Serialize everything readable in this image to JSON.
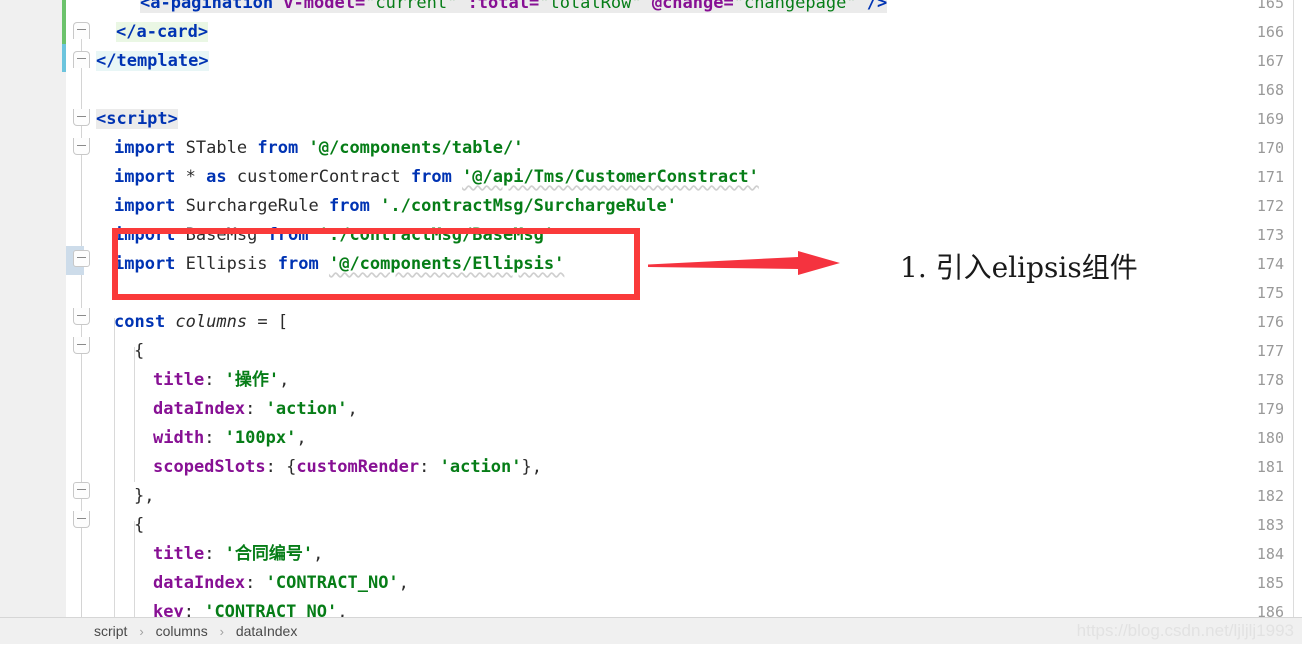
{
  "editor": {
    "language": "vue-javascript",
    "first_visible_line": 165,
    "last_visible_line": 186,
    "line_numbers": [
      165,
      166,
      167,
      168,
      169,
      170,
      171,
      172,
      173,
      174,
      175,
      176,
      177,
      178,
      179,
      180,
      181,
      182,
      183,
      184,
      185,
      186
    ],
    "lines": [
      {
        "n": 165,
        "text": "      <a-pagination v-model=\"current\" :total=\"totalRow\" @change=\"changepage\" />"
      },
      {
        "n": 166,
        "text": "    </a-card>"
      },
      {
        "n": 167,
        "text": "  </template>"
      },
      {
        "n": 168,
        "text": ""
      },
      {
        "n": 169,
        "text": "  <script>"
      },
      {
        "n": 170,
        "text": "    import STable from '@/components/table/'"
      },
      {
        "n": 171,
        "text": "    import * as customerContract from '@/api/Tms/CustomerConstract'"
      },
      {
        "n": 172,
        "text": "    import SurchargeRule from './contractMsg/SurchargeRule'"
      },
      {
        "n": 173,
        "text": "    import BaseMsg from './contractMsg/BaseMsg'"
      },
      {
        "n": 174,
        "text": "    import Ellipsis from '@/components/Ellipsis'"
      },
      {
        "n": 175,
        "text": ""
      },
      {
        "n": 176,
        "text": "    const columns = ["
      },
      {
        "n": 177,
        "text": "      {"
      },
      {
        "n": 178,
        "text": "        title: '操作',"
      },
      {
        "n": 179,
        "text": "        dataIndex: 'action',"
      },
      {
        "n": 180,
        "text": "        width: '100px',"
      },
      {
        "n": 181,
        "text": "        scopedSlots: {customRender: 'action'},"
      },
      {
        "n": 182,
        "text": "      },"
      },
      {
        "n": 183,
        "text": "      {"
      },
      {
        "n": 184,
        "text": "        title: '合同编号',"
      },
      {
        "n": 185,
        "text": "        dataIndex: 'CONTRACT_NO',"
      },
      {
        "n": 186,
        "text": "        key: 'CONTRACT_NO',"
      }
    ],
    "tokens": {
      "line165": [
        {
          "t": "<a-pagination ",
          "c": "tag",
          "bg": "bggray"
        },
        {
          "t": "v-model=",
          "c": "attr",
          "bg": "bggray"
        },
        {
          "t": "\"current\"",
          "c": "attrv",
          "bg": "bggray"
        },
        {
          "t": " ",
          "c": "plain",
          "bg": "bggray"
        },
        {
          "t": ":total=",
          "c": "attr",
          "bg": "bggray"
        },
        {
          "t": "\"totalRow\"",
          "c": "attrv",
          "bg": "bggray"
        },
        {
          "t": " ",
          "c": "plain",
          "bg": "bggray"
        },
        {
          "t": "@change=",
          "c": "attr",
          "bg": "bggray"
        },
        {
          "t": "\"changepage\"",
          "c": "attrv",
          "bg": "bggray"
        },
        {
          "t": " />",
          "c": "tag",
          "bg": "bggray"
        }
      ],
      "line166": [
        {
          "t": "</a-card>",
          "c": "tag",
          "bg": "bggreen"
        }
      ],
      "line167": [
        {
          "t": "</template>",
          "c": "tag",
          "bg": "bgtag"
        }
      ],
      "line169": [
        {
          "t": "<script>",
          "c": "tag",
          "bg": "bggray"
        }
      ],
      "line170": [
        {
          "t": "import ",
          "c": "kw"
        },
        {
          "t": "STable ",
          "c": "id"
        },
        {
          "t": "from ",
          "c": "kw"
        },
        {
          "t": "'@/components/table/'",
          "c": "str"
        }
      ],
      "line171": [
        {
          "t": "import ",
          "c": "kw"
        },
        {
          "t": "* ",
          "c": "plain"
        },
        {
          "t": "as ",
          "c": "kw"
        },
        {
          "t": "customerContract ",
          "c": "id"
        },
        {
          "t": "from ",
          "c": "kw"
        },
        {
          "t": "'@/api/Tms/CustomerConstract'",
          "c": "str",
          "wavy": true
        }
      ],
      "line172": [
        {
          "t": "import ",
          "c": "kw"
        },
        {
          "t": "SurchargeRule ",
          "c": "id"
        },
        {
          "t": "from ",
          "c": "kw"
        },
        {
          "t": "'./contractMsg/SurchargeRule'",
          "c": "str"
        }
      ],
      "line173": [
        {
          "t": "import ",
          "c": "kw"
        },
        {
          "t": "BaseMsg ",
          "c": "id"
        },
        {
          "t": "from ",
          "c": "kw"
        },
        {
          "t": "'./contractMsg/BaseMsg'",
          "c": "str"
        }
      ],
      "line174": [
        {
          "t": "import ",
          "c": "kw"
        },
        {
          "t": "Ellipsis ",
          "c": "id"
        },
        {
          "t": "from ",
          "c": "kw"
        },
        {
          "t": "'@/components/Ellipsis'",
          "c": "str",
          "wavy": true
        }
      ],
      "line176": [
        {
          "t": "const ",
          "c": "kw"
        },
        {
          "t": "columns",
          "c": "id italic"
        },
        {
          "t": " = [",
          "c": "plain"
        }
      ],
      "line177": [
        {
          "t": "{",
          "c": "plain"
        }
      ],
      "line178": [
        {
          "t": "title",
          "c": "prop"
        },
        {
          "t": ": ",
          "c": "plain"
        },
        {
          "t": "'操作'",
          "c": "str"
        },
        {
          "t": ",",
          "c": "plain"
        }
      ],
      "line179": [
        {
          "t": "dataIndex",
          "c": "prop"
        },
        {
          "t": ": ",
          "c": "plain"
        },
        {
          "t": "'action'",
          "c": "str"
        },
        {
          "t": ",",
          "c": "plain"
        }
      ],
      "line180": [
        {
          "t": "width",
          "c": "prop"
        },
        {
          "t": ": ",
          "c": "plain"
        },
        {
          "t": "'100px'",
          "c": "str"
        },
        {
          "t": ",",
          "c": "plain"
        }
      ],
      "line181": [
        {
          "t": "scopedSlots",
          "c": "prop"
        },
        {
          "t": ": {",
          "c": "plain"
        },
        {
          "t": "customRender",
          "c": "prop"
        },
        {
          "t": ": ",
          "c": "plain"
        },
        {
          "t": "'action'",
          "c": "str"
        },
        {
          "t": "},",
          "c": "plain"
        }
      ],
      "line182": [
        {
          "t": "},",
          "c": "plain"
        }
      ],
      "line183": [
        {
          "t": "{",
          "c": "plain"
        }
      ],
      "line184": [
        {
          "t": "title",
          "c": "prop"
        },
        {
          "t": ": ",
          "c": "plain"
        },
        {
          "t": "'合同编号'",
          "c": "str"
        },
        {
          "t": ",",
          "c": "plain"
        }
      ],
      "line185": [
        {
          "t": "dataIndex",
          "c": "prop"
        },
        {
          "t": ": ",
          "c": "plain"
        },
        {
          "t": "'CONTRACT_NO'",
          "c": "str"
        },
        {
          "t": ",",
          "c": "plain"
        }
      ],
      "line186": [
        {
          "t": "key",
          "c": "prop"
        },
        {
          "t": ": ",
          "c": "plain"
        },
        {
          "t": "'CONTRACT_NO'",
          "c": "str"
        },
        {
          "t": ",",
          "c": "plain"
        }
      ]
    }
  },
  "annotation": {
    "note_text": "1. 引入elipsis组件",
    "box_color": "#fa3a3a",
    "arrow_color": "#f5333f",
    "highlighted_lines": [
      173,
      174
    ]
  },
  "breadcrumb": {
    "separator": "›",
    "items": [
      "script",
      "columns",
      "dataIndex"
    ]
  },
  "watermark": {
    "text": "https://blog.csdn.net/ljljlj1993"
  },
  "colors": {
    "gutter_bg": "#f0f0f0",
    "editor_bg": "#ffffff",
    "keyword": "#0033b3",
    "string": "#067d17",
    "property": "#871094",
    "line_number": "#999999",
    "vcs_added": "#6cc26c",
    "vcs_changed": "#6cc4dd",
    "caret_row_gutter": "#cddcea"
  }
}
